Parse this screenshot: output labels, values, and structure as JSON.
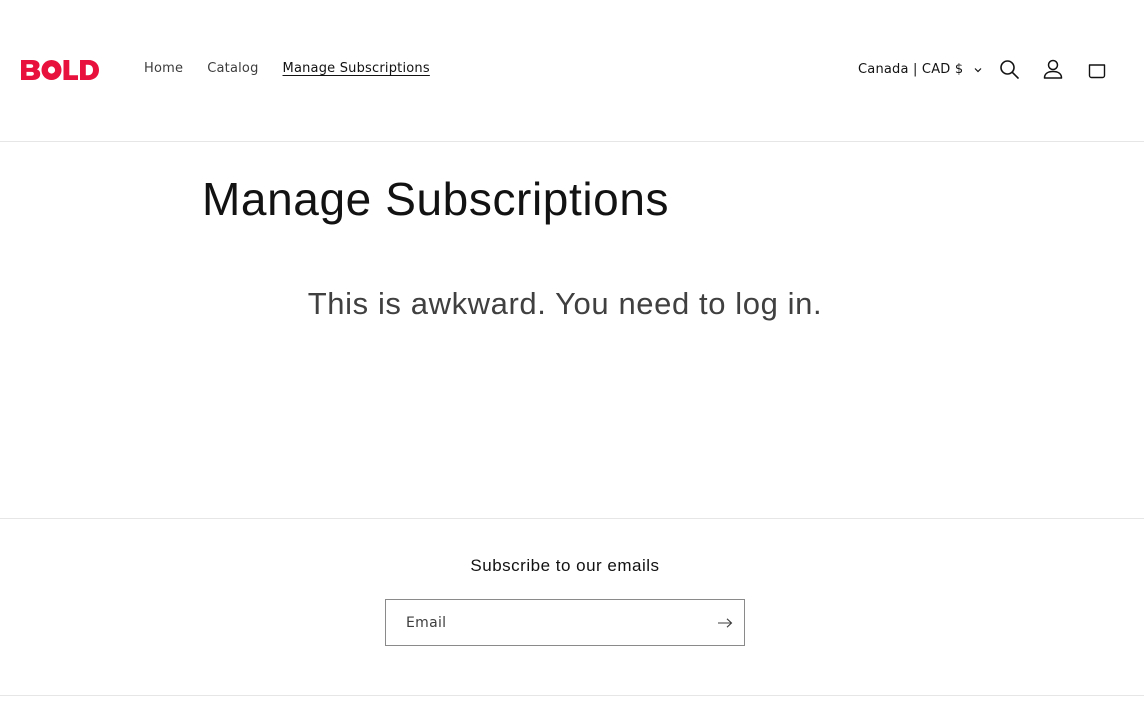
{
  "brand": {
    "logo_text": "BOLD",
    "logo_color": "#e8103c"
  },
  "nav": {
    "items": [
      {
        "label": "Home"
      },
      {
        "label": "Catalog"
      },
      {
        "label": "Manage Subscriptions",
        "active": true
      }
    ]
  },
  "header": {
    "country_selector": "Canada | CAD $",
    "icons": [
      "search-icon",
      "account-icon",
      "cart-icon"
    ]
  },
  "main": {
    "title": "Manage Subscriptions",
    "message": "This is awkward. You need to log in."
  },
  "newsletter": {
    "heading": "Subscribe to our emails",
    "email_placeholder": "Email",
    "submit_icon": "arrow-right-icon"
  }
}
